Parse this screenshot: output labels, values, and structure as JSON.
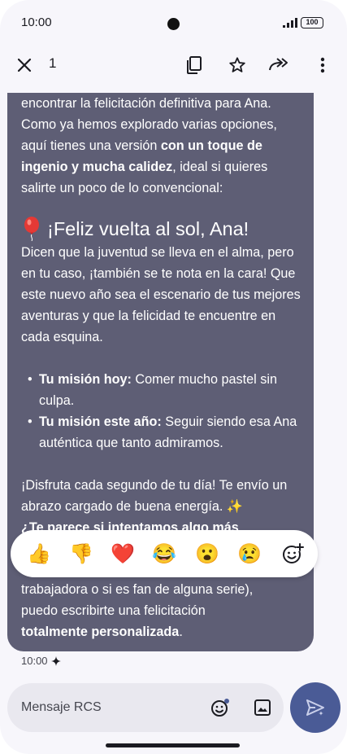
{
  "status_bar": {
    "time": "10:00",
    "battery": "100"
  },
  "action_bar": {
    "selected_count": "1",
    "icons": [
      "close-icon",
      "copy-icon",
      "star-icon",
      "forward-icon",
      "more-vert-icon"
    ]
  },
  "message": {
    "intro_line": "encontrar la felicitación definitiva para Ana.",
    "intro_rest_a": "Como ya hemos explorado varias opciones, aquí tienes una versión ",
    "intro_bold": "con un toque de ingenio y mucha calidez",
    "intro_rest_b": ", ideal si quieres salirte un poco de lo convencional:",
    "heading_emoji": "balloon",
    "heading": "¡Feliz vuelta al sol, Ana!",
    "body": "Dicen que la juventud se lleva en el alma, pero en tu caso, ¡también se te nota en la cara! Que este nuevo año sea el escenario de tus mejores aventuras y que la felicidad te encuentre en cada esquina.",
    "missions": [
      {
        "label": "Tu misión hoy:",
        "text": " Comer mucho pastel sin culpa."
      },
      {
        "label": "Tu misión este año:",
        "text": " Seguir siendo esa Ana auténtica que tanto admiramos."
      }
    ],
    "closing": "¡Disfruta cada segundo de tu día! Te envío un abrazo cargado de buena energía. ",
    "closing_sparkle": "✨",
    "question_partial": "¿Te parece si intentamos algo más",
    "after_line_1": "trabajadora o si es fan de alguna serie),",
    "after_line_2": "puedo escribirte una felicitación",
    "after_bold": "totalmente personalizada",
    "after_end": ".",
    "timestamp": "10:00",
    "colors": {
      "bubble": "#5e5e75",
      "accent": "#4a5b96"
    }
  },
  "reactions": [
    "👍",
    "👎",
    "❤️",
    "😂",
    "😮",
    "😢"
  ],
  "reaction_icons": [
    "thumbs-up-icon",
    "thumbs-down-icon",
    "heart-icon",
    "laughing-icon",
    "surprised-icon",
    "sad-icon",
    "add-reaction-icon"
  ],
  "compose": {
    "placeholder": "Mensaje RCS"
  }
}
